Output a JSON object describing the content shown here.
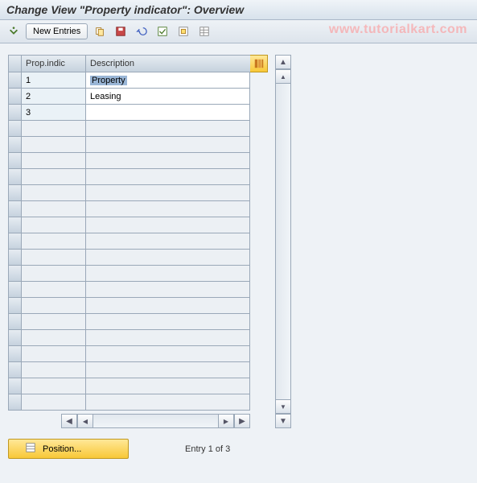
{
  "title": "Change View \"Property indicator\": Overview",
  "watermark": "www.tutorialkart.com",
  "toolbar": {
    "new_entries_label": "New Entries"
  },
  "table": {
    "headers": {
      "indicator": "Prop.indic",
      "description": "Description"
    },
    "rows": [
      {
        "indicator": "1",
        "description": "Property",
        "selected": true
      },
      {
        "indicator": "2",
        "description": "Leasing"
      },
      {
        "indicator": "3",
        "description": ""
      }
    ],
    "empty_row_count": 18
  },
  "footer": {
    "position_label": "Position...",
    "entry_text": "Entry 1 of 3"
  }
}
